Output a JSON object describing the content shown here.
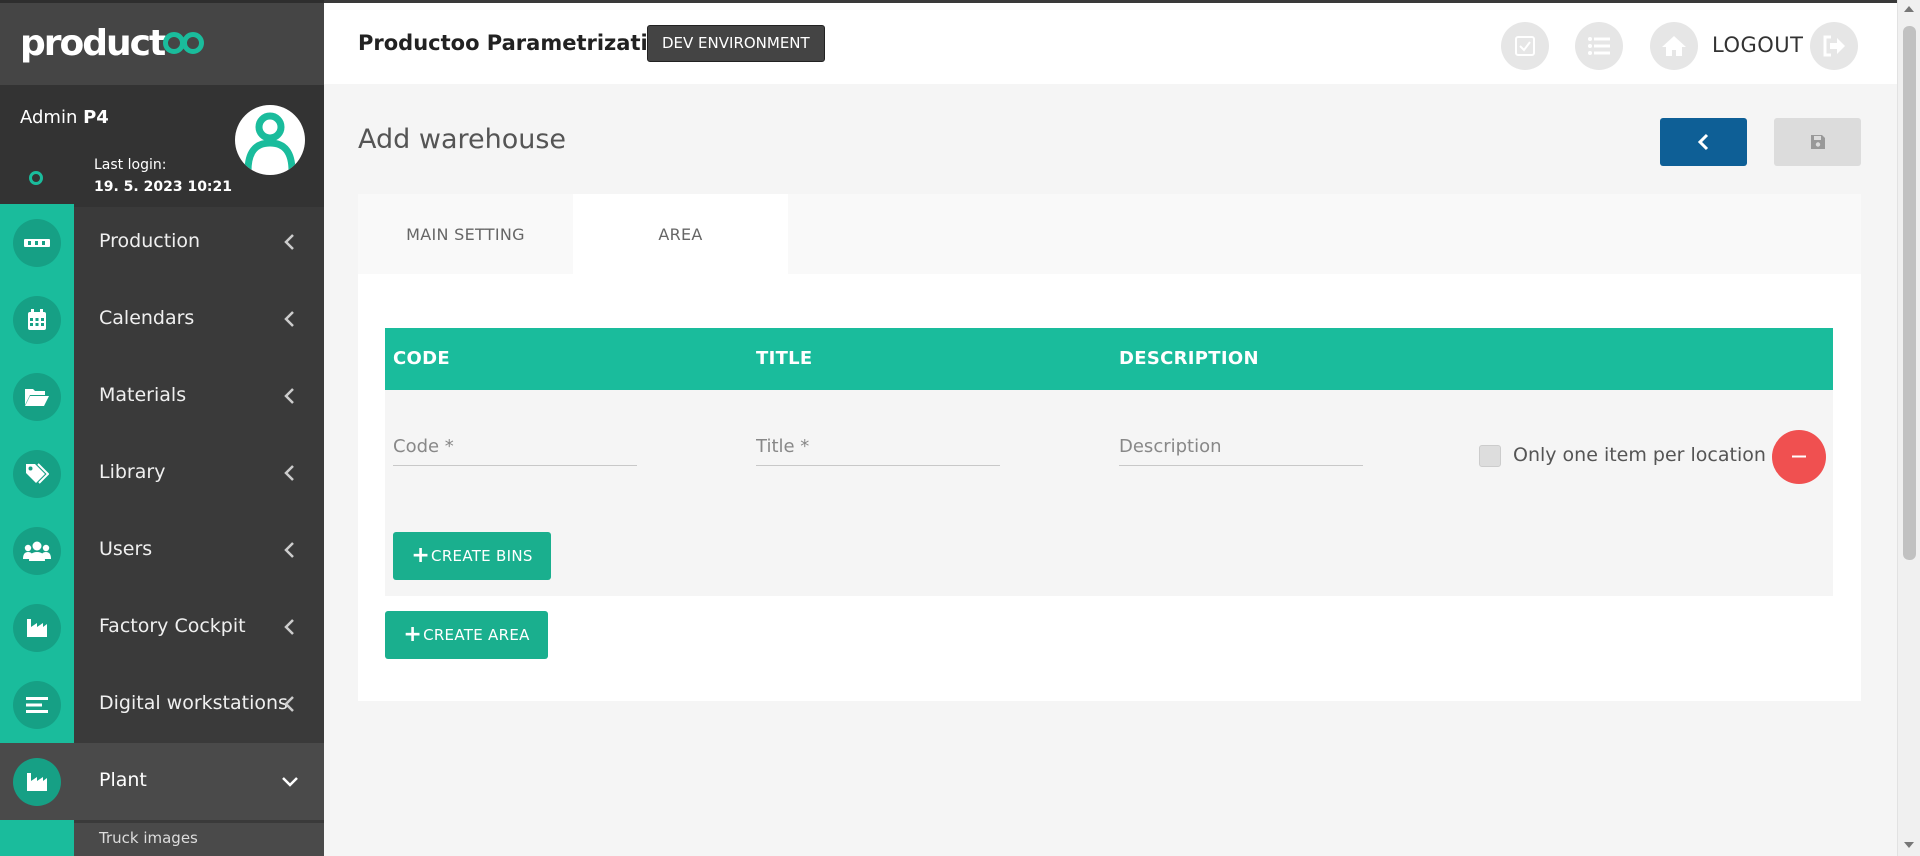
{
  "brand": {
    "logo_text": "product",
    "accent": "#1abc9c",
    "sidebar_bg": "#3a3a3a"
  },
  "user": {
    "name_prefix": "Admin",
    "name_suffix": "P4",
    "last_login_label": "Last login:",
    "last_login_value": "19. 5. 2023 10:21"
  },
  "sidebar": {
    "items": [
      {
        "label": "Production",
        "icon": "conveyor-icon"
      },
      {
        "label": "Calendars",
        "icon": "calendar-icon"
      },
      {
        "label": "Materials",
        "icon": "folder-icon"
      },
      {
        "label": "Library",
        "icon": "tags-icon"
      },
      {
        "label": "Users",
        "icon": "users-icon"
      },
      {
        "label": "Factory Cockpit",
        "icon": "factory-icon"
      },
      {
        "label": "Digital workstations",
        "icon": "list-icon"
      },
      {
        "label": "Plant",
        "icon": "factory-icon",
        "expanded": true
      }
    ],
    "sub_items": [
      "Truck images"
    ]
  },
  "header": {
    "title": "Productoo Parametrization",
    "environment": "DEV ENVIRONMENT",
    "logout_label": "LOGOUT"
  },
  "page": {
    "title": "Add warehouse",
    "tabs": [
      {
        "label": "MAIN SETTING",
        "active": false
      },
      {
        "label": "AREA",
        "active": true
      }
    ]
  },
  "table": {
    "columns": [
      "CODE",
      "TITLE",
      "DESCRIPTION"
    ],
    "row": {
      "code_placeholder": "Code *",
      "title_placeholder": "Title *",
      "description_placeholder": "Description",
      "only_one_label": "Only one item per location"
    },
    "create_bins_label": "CREATE BINS",
    "create_area_label": "CREATE AREA"
  }
}
